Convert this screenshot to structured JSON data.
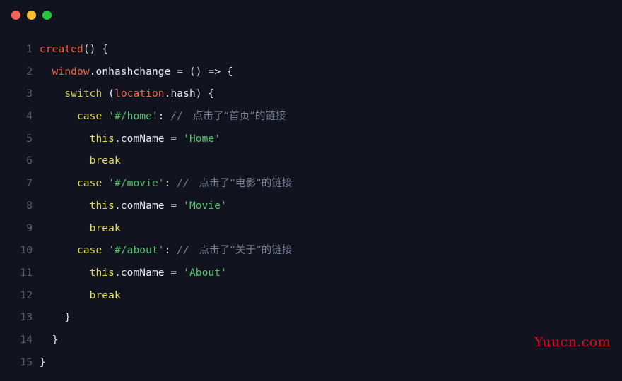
{
  "window": {
    "titlebar": {
      "close_label": "close",
      "minimize_label": "minimize",
      "maximize_label": "maximize"
    },
    "colors": {
      "background": "#11131f",
      "dot_close": "#f8625b",
      "dot_minimize": "#f9bd2f",
      "dot_maximize": "#27c83f",
      "line_number": "#5b6270",
      "text": "#e6e9ef",
      "orange": "#ec6a3b",
      "yellow": "#e4dc54",
      "green": "#4ec76a",
      "comment": "#7b8598",
      "watermark": "#e8051c"
    }
  },
  "editor": {
    "language": "javascript",
    "line_count": 15,
    "line_numbers": [
      "1",
      "2",
      "3",
      "4",
      "5",
      "6",
      "7",
      "8",
      "9",
      "10",
      "11",
      "12",
      "13",
      "14",
      "15"
    ],
    "lines": [
      {
        "number": "1",
        "tokens": [
          {
            "text": "created",
            "type": "fn"
          },
          {
            "text": "() {",
            "type": "punc"
          }
        ]
      },
      {
        "number": "2",
        "tokens": [
          {
            "text": "  ",
            "type": "punc"
          },
          {
            "text": "window",
            "type": "obj"
          },
          {
            "text": ".onhashchange = () => {",
            "type": "punc"
          }
        ]
      },
      {
        "number": "3",
        "tokens": [
          {
            "text": "    ",
            "type": "punc"
          },
          {
            "text": "switch",
            "type": "kw2"
          },
          {
            "text": " (",
            "type": "punc"
          },
          {
            "text": "location",
            "type": "obj"
          },
          {
            "text": ".hash) {",
            "type": "punc"
          }
        ]
      },
      {
        "number": "4",
        "tokens": [
          {
            "text": "      ",
            "type": "punc"
          },
          {
            "text": "case",
            "type": "kw"
          },
          {
            "text": " ",
            "type": "punc"
          },
          {
            "text": "'#/home'",
            "type": "str"
          },
          {
            "text": ": ",
            "type": "punc"
          },
          {
            "text": "// ",
            "type": "comment"
          },
          {
            "text": " 点击了“首页”的链接",
            "type": "comment-cn"
          }
        ]
      },
      {
        "number": "5",
        "tokens": [
          {
            "text": "        ",
            "type": "punc"
          },
          {
            "text": "this",
            "type": "kw"
          },
          {
            "text": ".comName = ",
            "type": "punc"
          },
          {
            "text": "'Home'",
            "type": "str"
          }
        ]
      },
      {
        "number": "6",
        "tokens": [
          {
            "text": "        ",
            "type": "punc"
          },
          {
            "text": "break",
            "type": "kw"
          }
        ]
      },
      {
        "number": "7",
        "tokens": [
          {
            "text": "      ",
            "type": "punc"
          },
          {
            "text": "case",
            "type": "kw"
          },
          {
            "text": " ",
            "type": "punc"
          },
          {
            "text": "'#/movie'",
            "type": "str"
          },
          {
            "text": ": ",
            "type": "punc"
          },
          {
            "text": "// ",
            "type": "comment"
          },
          {
            "text": " 点击了“电影”的链接",
            "type": "comment-cn"
          }
        ]
      },
      {
        "number": "8",
        "tokens": [
          {
            "text": "        ",
            "type": "punc"
          },
          {
            "text": "this",
            "type": "kw"
          },
          {
            "text": ".comName = ",
            "type": "punc"
          },
          {
            "text": "'Movie'",
            "type": "str"
          }
        ]
      },
      {
        "number": "9",
        "tokens": [
          {
            "text": "        ",
            "type": "punc"
          },
          {
            "text": "break",
            "type": "kw"
          }
        ]
      },
      {
        "number": "10",
        "tokens": [
          {
            "text": "      ",
            "type": "punc"
          },
          {
            "text": "case",
            "type": "kw"
          },
          {
            "text": " ",
            "type": "punc"
          },
          {
            "text": "'#/about'",
            "type": "str"
          },
          {
            "text": ": ",
            "type": "punc"
          },
          {
            "text": "// ",
            "type": "comment"
          },
          {
            "text": " 点击了“关于”的链接",
            "type": "comment-cn"
          }
        ]
      },
      {
        "number": "11",
        "tokens": [
          {
            "text": "        ",
            "type": "punc"
          },
          {
            "text": "this",
            "type": "kw"
          },
          {
            "text": ".comName = ",
            "type": "punc"
          },
          {
            "text": "'About'",
            "type": "str"
          }
        ]
      },
      {
        "number": "12",
        "tokens": [
          {
            "text": "        ",
            "type": "punc"
          },
          {
            "text": "break",
            "type": "kw"
          }
        ]
      },
      {
        "number": "13",
        "tokens": [
          {
            "text": "    }",
            "type": "punc"
          }
        ]
      },
      {
        "number": "14",
        "tokens": [
          {
            "text": "  }",
            "type": "punc"
          }
        ]
      },
      {
        "number": "15",
        "tokens": [
          {
            "text": "}",
            "type": "punc"
          }
        ]
      }
    ]
  },
  "watermark": {
    "text": "Yuucn.com"
  }
}
